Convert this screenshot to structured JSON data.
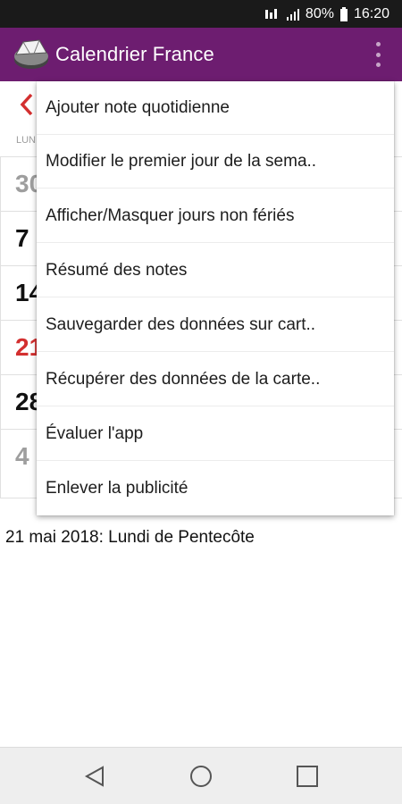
{
  "status_bar": {
    "battery": "80%",
    "time": "16:20",
    "icons": [
      "wifi-icon",
      "signal-icon",
      "battery-icon"
    ]
  },
  "app_bar": {
    "title": "Calendrier France",
    "logo_icon": "calendar-logo-icon",
    "overflow_icon": "more-vert-icon",
    "color": "#6d1d70"
  },
  "calendar": {
    "prev_icon": "chevron-left-icon",
    "weekday_first": "LUN",
    "weeks": [
      {
        "first_day": "30",
        "style": "gray"
      },
      {
        "first_day": "7",
        "style": "black"
      },
      {
        "first_day": "14",
        "style": "black"
      },
      {
        "first_day": "21",
        "style": "red"
      },
      {
        "first_day": "28",
        "style": "black"
      },
      {
        "first_day": "4",
        "style": "gray"
      }
    ]
  },
  "notes": {
    "holiday_line": "21 mai 2018: Lundi de Pentecôte"
  },
  "menu": {
    "items": [
      "Ajouter note quotidienne",
      "Modifier le premier jour de la sema..",
      "Afficher/Masquer jours non fériés",
      "Résumé des notes",
      "Sauvegarder des données sur cart..",
      "Récupérer des données de la carte..",
      "Évaluer l'app",
      "Enlever la publicité"
    ]
  },
  "nav_bar": {
    "icons": [
      "back-icon",
      "home-icon",
      "recents-icon"
    ]
  },
  "colors": {
    "accent": "#6d1d70",
    "holiday_red": "#d32f2f",
    "muted": "#9e9e9e"
  }
}
